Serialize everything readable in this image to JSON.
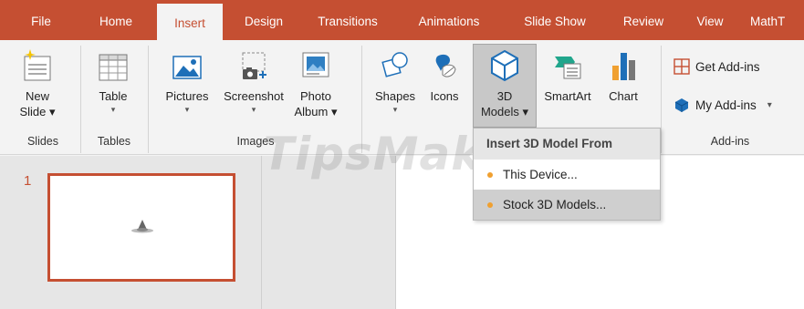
{
  "tabs": [
    "File",
    "Home",
    "Insert",
    "Design",
    "Transitions",
    "Animations",
    "Slide Show",
    "Review",
    "View",
    "MathT"
  ],
  "active_tab": "Insert",
  "ribbon": {
    "new_slide": {
      "line1": "New",
      "line2": "Slide ▾"
    },
    "table": {
      "label": "Table",
      "caret": "▾"
    },
    "pictures": {
      "label": "Pictures",
      "caret": "▾"
    },
    "screenshot": {
      "label": "Screenshot",
      "caret": "▾"
    },
    "photo_album": {
      "line1": "Photo",
      "line2": "Album ▾"
    },
    "shapes": {
      "label": "Shapes",
      "caret": "▾"
    },
    "icons": {
      "label": "Icons"
    },
    "models3d": {
      "line1": "3D",
      "line2": "Models ▾"
    },
    "smartart": {
      "label": "SmartArt"
    },
    "chart": {
      "label": "Chart"
    },
    "get_addins": "Get Add-ins",
    "my_addins": "My Add-ins",
    "my_addins_caret": "▾",
    "groups": {
      "slides": "Slides",
      "tables": "Tables",
      "images": "Images",
      "addins": "Add-ins"
    }
  },
  "dropdown": {
    "header": "Insert 3D Model From",
    "items": [
      "This Device...",
      "Stock 3D Models..."
    ]
  },
  "slide_panel": {
    "slide_number": "1"
  },
  "watermark": "TipsMake",
  "colors": {
    "accent": "#c54f32",
    "addins_icon": "#c54f32",
    "my_addins_icon": "#1e6fb8",
    "dot": "#f0a030"
  }
}
